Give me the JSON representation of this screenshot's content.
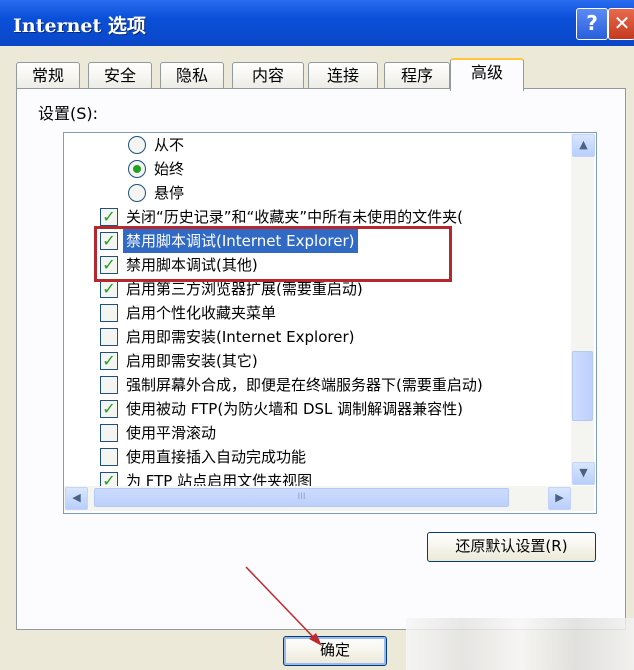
{
  "window": {
    "title": "Internet 选项",
    "help_label": "?",
    "close_label": "✕"
  },
  "tabs": [
    {
      "label": "常规"
    },
    {
      "label": "安全"
    },
    {
      "label": "隐私"
    },
    {
      "label": "内容"
    },
    {
      "label": "连接"
    },
    {
      "label": "程序"
    },
    {
      "label": "高级"
    }
  ],
  "active_tab": "高级",
  "settings_label": "设置(S):",
  "list": {
    "radios": [
      {
        "label": "从不",
        "selected": false
      },
      {
        "label": "始终",
        "selected": true
      },
      {
        "label": "悬停",
        "selected": false
      }
    ],
    "items": [
      {
        "label": "关闭“历史记录”和“收藏夹”中所有未使用的文件夹(",
        "checked": true
      },
      {
        "label": "禁用脚本调试(Internet Explorer)",
        "checked": true,
        "selected": true
      },
      {
        "label": "禁用脚本调试(其他)",
        "checked": true
      },
      {
        "label": "启用第三方浏览器扩展(需要重启动)",
        "checked": true
      },
      {
        "label": "启用个性化收藏夹菜单",
        "checked": false
      },
      {
        "label": "启用即需安装(Internet Explorer)",
        "checked": false
      },
      {
        "label": "启用即需安装(其它)",
        "checked": true
      },
      {
        "label": "强制屏幕外合成，即便是在终端服务器下(需要重启动)",
        "checked": false
      },
      {
        "label": "使用被动 FTP(为防火墙和 DSL 调制解调器兼容性)",
        "checked": true
      },
      {
        "label": "使用平滑滚动",
        "checked": false
      },
      {
        "label": "使用直接插入自动完成功能",
        "checked": false
      },
      {
        "label": "为 FTP 站点启用文件夹视图",
        "checked": true
      }
    ]
  },
  "scroll": {
    "up": "▲",
    "down": "▼",
    "left": "◀",
    "right": "▶",
    "h_grip": "III"
  },
  "buttons": {
    "restore": "还原默认设置(R)",
    "ok": "确定"
  },
  "colors": {
    "highlight_box": "#b4282e",
    "check": "#21a121",
    "title_bar": "#0a4fd8"
  }
}
